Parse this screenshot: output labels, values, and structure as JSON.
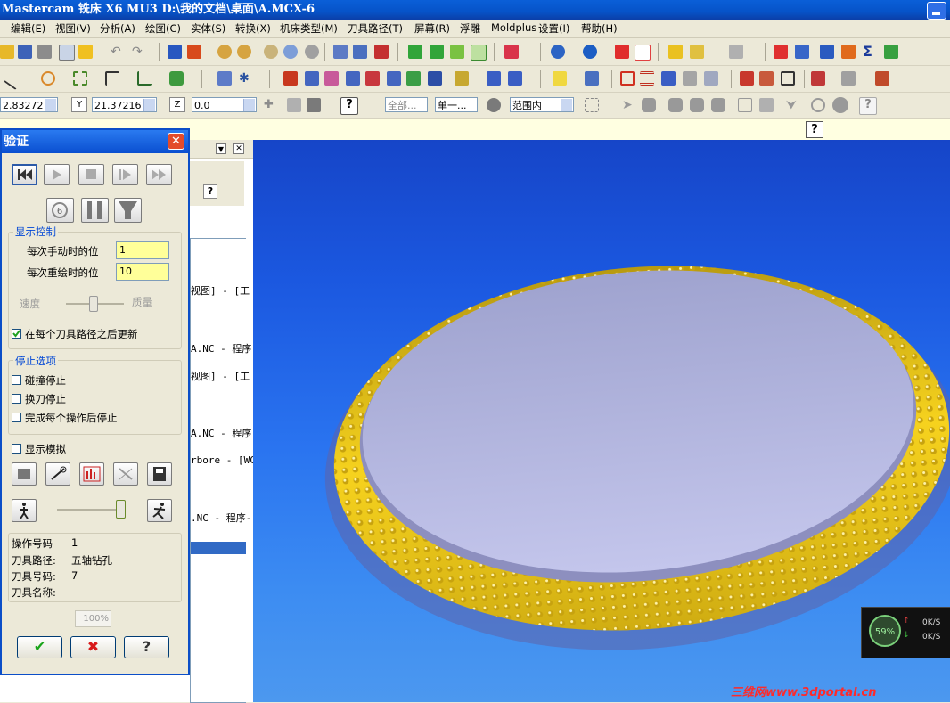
{
  "window": {
    "title": "Mastercam 铣床 X6 MU3  D:\\我的文档\\桌面\\A.MCX-6"
  },
  "menu": [
    "编辑(E)",
    "视图(V)",
    "分析(A)",
    "绘图(C)",
    "实体(S)",
    "转换(X)",
    "机床类型(M)",
    "刀具路径(T)",
    "屏幕(R)",
    "浮雕",
    "Moldplus",
    "设置(I)",
    "帮助(H)"
  ],
  "coords": {
    "x_value": "2.83272",
    "y_label": "Y",
    "y_value": "21.37216",
    "z_label": "Z",
    "z_value": "0.0",
    "filter": "全部...",
    "single": "单一...",
    "range": "范围内"
  },
  "help_icon": "?",
  "opman": {
    "lines": [
      "视图] - [工",
      "A.NC - 程序",
      "视图] - [工",
      "A.NC - 程序",
      "rbore - [WC",
      ".NC - 程序-"
    ]
  },
  "dialog": {
    "title": "验证",
    "close": "✕",
    "display_group": "显示控制",
    "steps_label": "每次手动时的位",
    "steps_value": "1",
    "redraw_label": "每次重绘时的位",
    "redraw_value": "10",
    "speed_label": "速度",
    "quality_label": "质量",
    "update_label": "在每个刀具路径之后更新",
    "update_checked": true,
    "stop_group": "停止选项",
    "stop_collision": "碰撞停止",
    "stop_toolchange": "换刀停止",
    "stop_after_op": "完成每个操作后停止",
    "show_sim": "显示模拟",
    "info": {
      "op_label": "操作号码",
      "op_value": "1",
      "path_label": "刀具路径:",
      "path_value": "五轴钻孔",
      "toolno_label": "刀具号码:",
      "toolno_value": "7",
      "toolname_label": "刀具名称:",
      "toolname_value": ""
    },
    "progress": "100%",
    "ok": "✔",
    "cancel": "✖",
    "help": "?"
  },
  "net_widget": {
    "percent": "59%",
    "up": "0K/S",
    "down": "0K/S"
  },
  "watermark": "三维网www.3dportal.cn",
  "colors": {
    "accent": "#0a4fd0",
    "viewport_top": "#1645c8",
    "rim": "#f2d21c",
    "part_face": "#b9bde6"
  }
}
